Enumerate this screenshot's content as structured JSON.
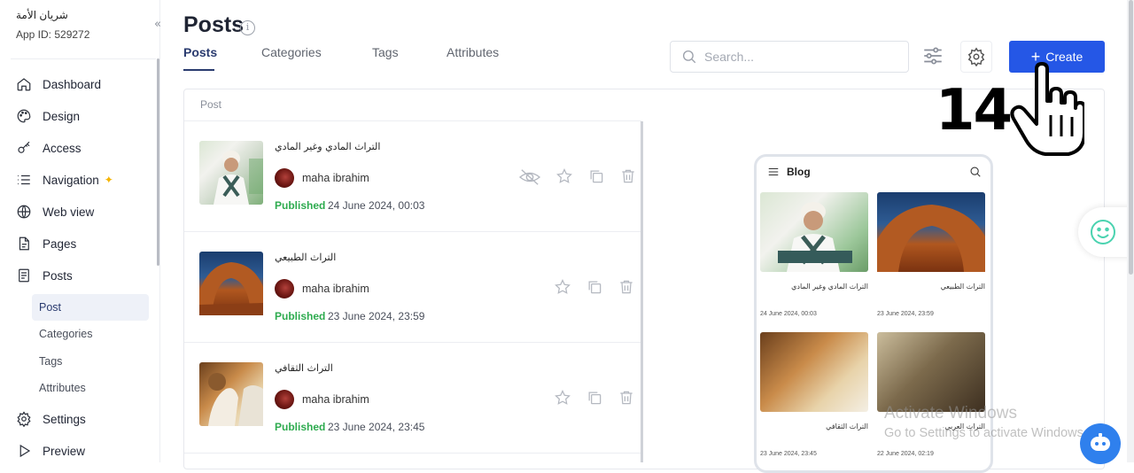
{
  "sidebar": {
    "app_name": "شريان الأمة",
    "app_id": "App ID: 529272",
    "items": [
      {
        "label": "Dashboard"
      },
      {
        "label": "Design"
      },
      {
        "label": "Access"
      },
      {
        "label": "Navigation"
      },
      {
        "label": "Web view"
      },
      {
        "label": "Pages"
      },
      {
        "label": "Posts"
      },
      {
        "label": "Settings"
      },
      {
        "label": "Preview"
      }
    ],
    "sub_items": [
      {
        "label": "Post"
      },
      {
        "label": "Categories"
      },
      {
        "label": "Tags"
      },
      {
        "label": "Attributes"
      }
    ]
  },
  "header": {
    "title": "Posts",
    "info_glyph": "i",
    "tabs": [
      {
        "label": "Posts"
      },
      {
        "label": "Categories"
      },
      {
        "label": "Tags"
      },
      {
        "label": "Attributes"
      }
    ],
    "search_placeholder": "Search...",
    "create_label": "Create",
    "create_icon": "+"
  },
  "tutorial": {
    "step": "14"
  },
  "list": {
    "column_label": "Post",
    "posts": [
      {
        "title": "التراث المادي وغير المادي",
        "author": "maha ibrahim",
        "status": "Published",
        "date": "24 June 2024, 00:03"
      },
      {
        "title": "التراث الطبيعي",
        "author": "maha ibrahim",
        "status": "Published",
        "date": "23 June 2024, 23:59"
      },
      {
        "title": "التراث الثقافي",
        "author": "maha ibrahim",
        "status": "Published",
        "date": "23 June 2024, 23:45"
      }
    ]
  },
  "preview": {
    "header": "Blog",
    "cards": [
      {
        "title": "التراث المادي وغير المادي",
        "date": "24 June 2024, 00:03"
      },
      {
        "title": "التراث الطبيعي",
        "date": "23 June 2024, 23:59"
      },
      {
        "title": "التراث الثقافي",
        "date": "23 June 2024, 23:45"
      },
      {
        "title": "التراث العربي",
        "date": "22 June 2024, 02:19"
      }
    ]
  },
  "watermark": {
    "line1": "Activate Windows",
    "line2": "Go to Settings to activate Windows."
  },
  "colors": {
    "accent": "#2557e6",
    "published": "#2eab4f",
    "active_nav": "#2a3b6f"
  }
}
